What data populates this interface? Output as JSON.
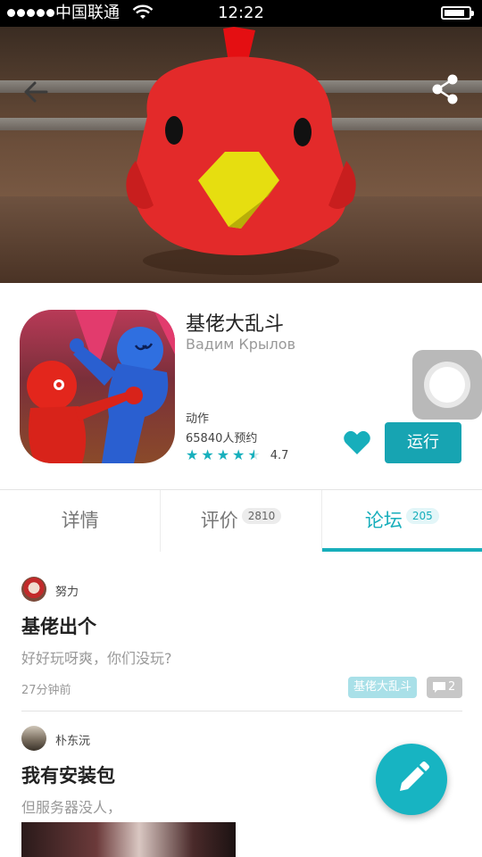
{
  "status_bar": {
    "carrier": "中国联通",
    "time": "12:22"
  },
  "app": {
    "name": "基佬大乱斗",
    "developer": "Вадим Крылов",
    "category": "动作",
    "reservations": "65840人预约",
    "rating": "4.7",
    "stars_filled": 4.5,
    "run_label": "运行"
  },
  "tabs": [
    {
      "label": "详情",
      "badge": ""
    },
    {
      "label": "评价",
      "badge": "2810"
    },
    {
      "label": "论坛",
      "badge": "205"
    }
  ],
  "posts": [
    {
      "author": "努力",
      "title": "基佬出个",
      "body": "好好玩呀爽，你们没玩?",
      "time": "27分钟前",
      "tag": "基佬大乱斗",
      "comment_count": "2"
    },
    {
      "author": "朴东沅",
      "title": "我有安装包",
      "body": "但服务器没人，"
    }
  ],
  "colors": {
    "accent": "#17aebb",
    "run_button": "#17a4b2",
    "hero_chicken": "#e02a2a"
  },
  "icons": {
    "back": "arrow-left-icon",
    "share": "share-icon",
    "favorite": "heart-icon",
    "comment": "comment-icon",
    "compose": "pencil-icon"
  }
}
